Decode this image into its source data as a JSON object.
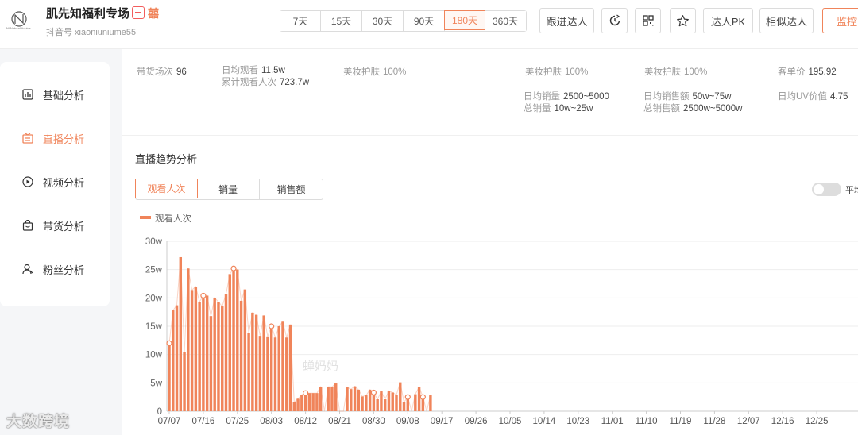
{
  "header": {
    "name": "肌先知福利专场",
    "tag": "囍",
    "account": "抖音号 xiaoniuniume55",
    "logo_text": "All Natural Advice"
  },
  "date_ranges": [
    {
      "label": "7天",
      "active": false
    },
    {
      "label": "15天",
      "active": false
    },
    {
      "label": "30天",
      "active": false
    },
    {
      "label": "90天",
      "active": false
    },
    {
      "label": "180天",
      "active": true
    },
    {
      "label": "360天",
      "active": false
    }
  ],
  "actions": {
    "follow": "跟进达人",
    "pk": "达人PK",
    "similar": "相似达人",
    "monitor": "监控"
  },
  "sidebar": {
    "items": [
      {
        "label": "基础分析",
        "icon": "bar-chart-icon",
        "active": false
      },
      {
        "label": "直播分析",
        "icon": "live-icon",
        "active": true
      },
      {
        "label": "视频分析",
        "icon": "play-icon",
        "active": false
      },
      {
        "label": "带货分析",
        "icon": "bag-icon",
        "active": false
      },
      {
        "label": "粉丝分析",
        "icon": "user-icon",
        "active": false
      }
    ]
  },
  "stats": {
    "sessions_label": "带货场次",
    "sessions": "96",
    "avg_view_label": "日均观看",
    "avg_view": "11.5w",
    "total_view_label": "累计观看人次",
    "total_view": "723.7w",
    "cat1_label": "美妆护肤",
    "cat1": "100%",
    "cat2_label": "美妆护肤",
    "cat2": "100%",
    "cat3_label": "美妆护肤",
    "cat3": "100%",
    "price_label": "客单价",
    "price": "195.92",
    "avg_sales_label": "日均销量",
    "avg_sales": "2500~5000",
    "total_sales_label": "总销量",
    "total_sales": "10w~25w",
    "avg_gmv_label": "日均销售额",
    "avg_gmv": "50w~75w",
    "total_gmv_label": "总销售额",
    "total_gmv": "2500w~5000w",
    "uv_label": "日均UV价值",
    "uv": "4.75"
  },
  "trend": {
    "title": "直播趋势分析",
    "tabs": [
      {
        "label": "观看人次",
        "active": true
      },
      {
        "label": "销量",
        "active": false
      },
      {
        "label": "销售额",
        "active": false
      }
    ],
    "toggle_label": "平均"
  },
  "chart_data": {
    "type": "bar",
    "legend": "观看人次",
    "legend_position": "top-left",
    "grid": true,
    "ylim": [
      0,
      30
    ],
    "y_unit": "w",
    "y_ticks": [
      "0",
      "5w",
      "10w",
      "15w",
      "20w",
      "25w",
      "30w"
    ],
    "x_ticks": [
      "07/07",
      "07/16",
      "07/25",
      "08/03",
      "08/12",
      "08/21",
      "08/30",
      "09/08",
      "09/17",
      "09/26",
      "10/05",
      "10/14",
      "10/23",
      "11/01",
      "11/10",
      "11/19",
      "11/28",
      "12/07",
      "12/16",
      "12/25"
    ],
    "values": [
      12,
      17.8,
      18.7,
      27.2,
      10.4,
      25.2,
      21.4,
      22,
      19.3,
      20.4,
      20.4,
      16.8,
      20,
      19.3,
      18.5,
      20.7,
      24.2,
      25.2,
      25,
      19.5,
      21.5,
      13.8,
      17.4,
      17,
      13.3,
      16.9,
      13.2,
      15,
      13,
      15,
      15.8,
      13,
      15.3,
      1.6,
      2.2,
      2.9,
      3.2,
      3.2,
      3.2,
      3.2,
      4.3,
      0,
      4.3,
      4.3,
      4.9,
      0,
      0,
      4.2,
      3.9,
      4.4,
      3.8,
      2.6,
      2.8,
      3.8,
      3.3,
      2.1,
      3.5,
      2.1,
      3.6,
      3.3,
      2.9,
      5.1,
      1.6,
      2.5,
      0,
      3,
      4.3,
      2.5,
      0,
      2.8
    ],
    "markers": [
      0,
      9,
      17,
      27,
      36,
      54,
      63,
      67
    ]
  },
  "watermark": "大数跨境",
  "chart_watermark": "蝉妈妈",
  "colors": {
    "accent": "#f0845a",
    "bar": "#f0845a"
  }
}
